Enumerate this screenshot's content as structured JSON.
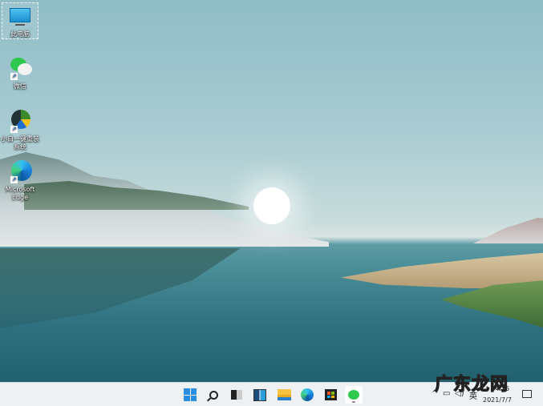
{
  "desktop_icons": [
    {
      "label": "此电脑",
      "icon": "this-pc-icon"
    },
    {
      "label": "微信",
      "icon": "wechat-icon"
    },
    {
      "label": "小白一键重装系统",
      "icon": "xiaobai-installer-icon"
    },
    {
      "label": "Microsoft Edge",
      "icon": "edge-icon"
    }
  ],
  "taskbar": {
    "apps": [
      "start-icon",
      "search-icon",
      "task-view-icon",
      "widgets-icon",
      "file-explorer-icon",
      "edge-icon",
      "store-icon",
      "wechat-icon"
    ],
    "tray": {
      "chevron": "^",
      "ime": "英",
      "time": "14:26",
      "date": "2021/7/7"
    }
  },
  "watermark": "广东龙网"
}
